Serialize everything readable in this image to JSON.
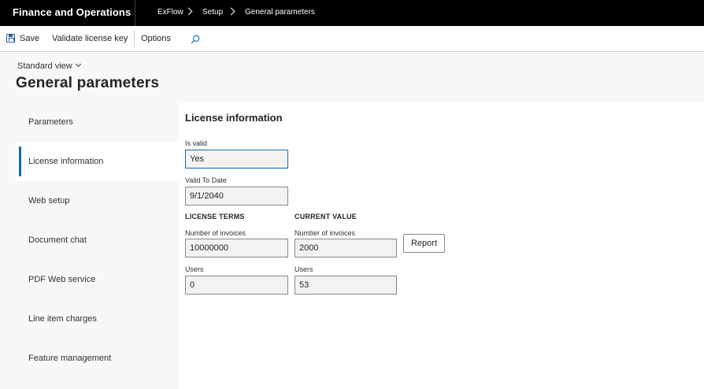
{
  "topbar": {
    "app_title": "Finance and Operations",
    "breadcrumb": [
      "ExFlow",
      "Setup",
      "General parameters"
    ]
  },
  "actions": {
    "save": "Save",
    "validate": "Validate license key",
    "options": "Options",
    "search_icon": "search-icon"
  },
  "header": {
    "view": "Standard view",
    "title": "General parameters"
  },
  "tabs": [
    {
      "label": "Parameters",
      "active": false
    },
    {
      "label": "License information",
      "active": true
    },
    {
      "label": "Web setup",
      "active": false
    },
    {
      "label": "Document chat",
      "active": false
    },
    {
      "label": "PDF Web service",
      "active": false
    },
    {
      "label": "Line item charges",
      "active": false
    },
    {
      "label": "Feature management",
      "active": false
    }
  ],
  "license": {
    "section_title": "License information",
    "is_valid": {
      "label": "Is valid",
      "value": "Yes"
    },
    "valid_to": {
      "label": "Valid To Date",
      "value": "9/1/2040"
    },
    "terms_header": "LICENSE TERMS",
    "current_header": "CURRENT VALUE",
    "terms": {
      "invoices": {
        "label": "Number of invoices",
        "value": "10000000"
      },
      "users": {
        "label": "Users",
        "value": "0"
      }
    },
    "current": {
      "invoices": {
        "label": "Number of invoices",
        "value": "2000"
      },
      "users": {
        "label": "Users",
        "value": "53"
      }
    },
    "report_button": "Report"
  },
  "colors": {
    "topbar_bg": "#000000",
    "accent": "#0f6cbd",
    "save_icon": "#2b579a"
  }
}
